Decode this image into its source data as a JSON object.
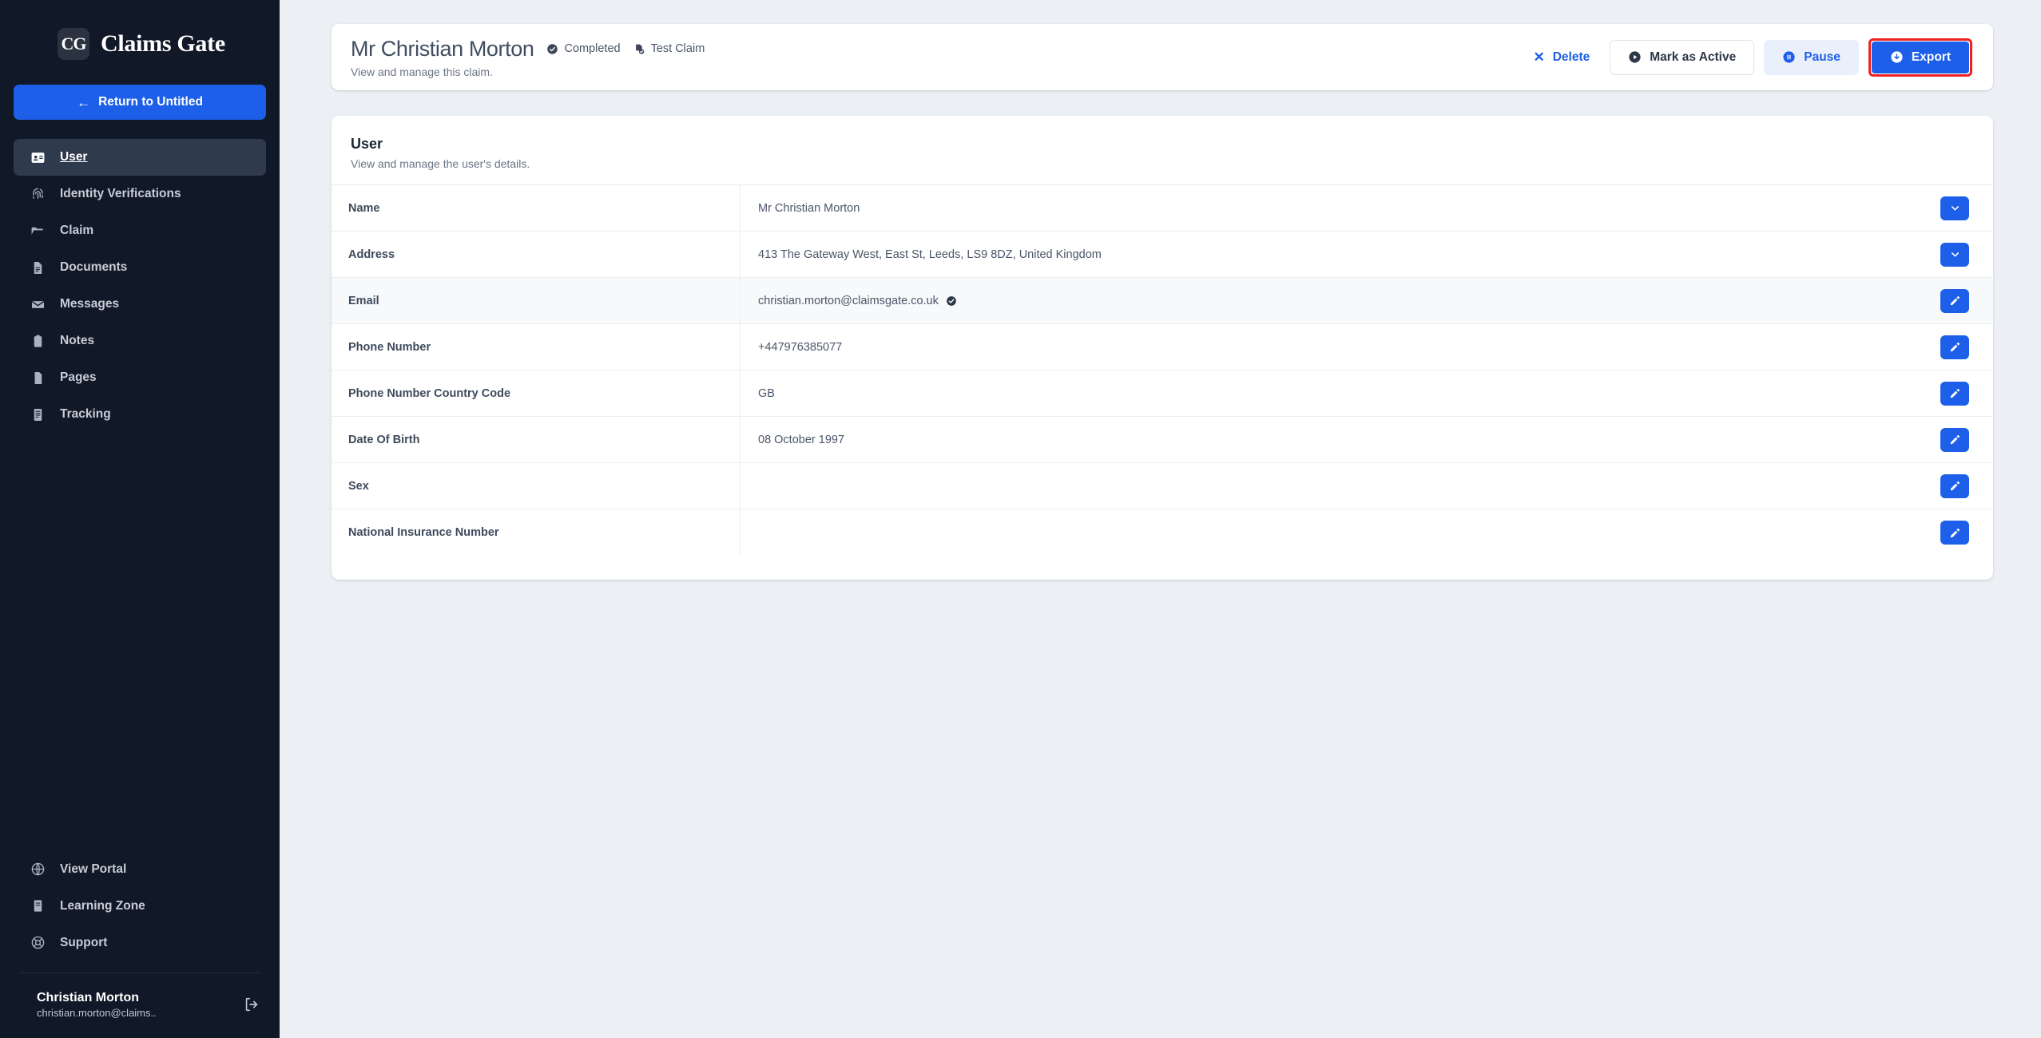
{
  "brand": {
    "mark": "CG",
    "name": "Claims Gate",
    "mark_icon": "claims-gate-logo"
  },
  "sidebar": {
    "return_button": {
      "label": "Return to Untitled",
      "icon": "arrow-left-icon"
    },
    "items": [
      {
        "label": "User",
        "icon": "id-card-icon",
        "active": true
      },
      {
        "label": "Identity Verifications",
        "icon": "fingerprint-icon",
        "active": false
      },
      {
        "label": "Claim",
        "icon": "folder-open-icon",
        "active": false
      },
      {
        "label": "Documents",
        "icon": "document-text-icon",
        "active": false
      },
      {
        "label": "Messages",
        "icon": "envelope-icon",
        "active": false
      },
      {
        "label": "Notes",
        "icon": "clipboard-icon",
        "active": false
      },
      {
        "label": "Pages",
        "icon": "page-icon",
        "active": false
      },
      {
        "label": "Tracking",
        "icon": "list-receipt-icon",
        "active": false
      }
    ],
    "bottom_items": [
      {
        "label": "View Portal",
        "icon": "globe-icon"
      },
      {
        "label": "Learning Zone",
        "icon": "book-icon"
      },
      {
        "label": "Support",
        "icon": "lifebuoy-icon"
      }
    ],
    "account": {
      "name": "Christian Morton",
      "email": "christian.morton@claims..",
      "logout_icon": "logout-icon"
    }
  },
  "header": {
    "title": "Mr Christian Morton",
    "subtitle": "View and manage this claim.",
    "badges": [
      {
        "label": "Completed",
        "icon": "check-circle-icon"
      },
      {
        "label": "Test Claim",
        "icon": "file-check-icon"
      }
    ],
    "actions": [
      {
        "label": "Delete",
        "icon": "x-icon",
        "style": "link"
      },
      {
        "label": "Mark as Active",
        "icon": "play-circle-icon",
        "style": "outline"
      },
      {
        "label": "Pause",
        "icon": "pause-circle-icon",
        "style": "soft"
      },
      {
        "label": "Export",
        "icon": "download-circle-icon",
        "style": "primary",
        "highlighted": true
      }
    ]
  },
  "user_card": {
    "title": "User",
    "subtitle": "View and manage the user's details.",
    "rows": [
      {
        "label": "Name",
        "value": "Mr Christian Morton",
        "action": "chevron-down-icon",
        "verified": false,
        "hover": false
      },
      {
        "label": "Address",
        "value": "413 The Gateway West, East St, Leeds, LS9 8DZ, United Kingdom",
        "action": "chevron-down-icon",
        "verified": false,
        "hover": false
      },
      {
        "label": "Email",
        "value": "christian.morton@claimsgate.co.uk",
        "action": "pencil-icon",
        "verified": true,
        "hover": true
      },
      {
        "label": "Phone Number",
        "value": "+447976385077",
        "action": "pencil-icon",
        "verified": false,
        "hover": false
      },
      {
        "label": "Phone Number Country Code",
        "value": "GB",
        "action": "pencil-icon",
        "verified": false,
        "hover": false
      },
      {
        "label": "Date Of Birth",
        "value": "08 October 1997",
        "action": "pencil-icon",
        "verified": false,
        "hover": false
      },
      {
        "label": "Sex",
        "value": "",
        "action": "pencil-icon",
        "verified": false,
        "hover": false
      },
      {
        "label": "National Insurance Number",
        "value": "",
        "action": "pencil-icon",
        "verified": false,
        "hover": false
      }
    ]
  },
  "colors": {
    "sidebar_bg": "#111827",
    "sidebar_active": "#2f3a4d",
    "accent_blue": "#1d5fe8",
    "page_bg": "#eceff3",
    "highlight_red": "#ef2121",
    "card_bg": "#ffffff"
  }
}
